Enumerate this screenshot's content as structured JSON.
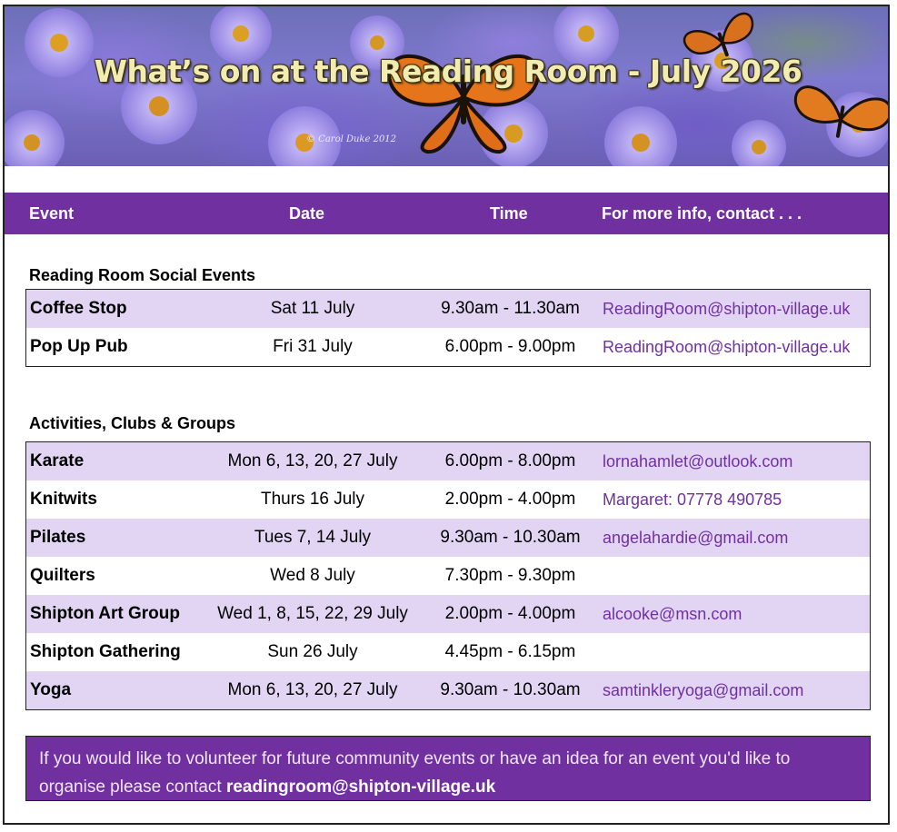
{
  "banner": {
    "title": "What’s on at the Reading Room - July 2026",
    "credit": "© Carol Duke 2012"
  },
  "columns": {
    "event": "Event",
    "date": "Date",
    "time": "Time",
    "contact": "For more info, contact . . ."
  },
  "social": {
    "title": "Reading Room Social Events",
    "rows": [
      {
        "name": "Coffee Stop",
        "date": "Sat 11 July",
        "time": "9.30am - 11.30am",
        "contact": "ReadingRoom@shipton-village.uk"
      },
      {
        "name": "Pop Up Pub",
        "date": "Fri 31 July",
        "time": "6.00pm - 9.00pm",
        "contact": "ReadingRoom@shipton-village.uk"
      }
    ]
  },
  "activities": {
    "title": "Activities, Clubs & Groups",
    "rows": [
      {
        "name": "Karate",
        "date": "Mon 6, 13, 20, 27 July",
        "time": "6.00pm - 8.00pm",
        "contact": "lornahamlet@outlook.com"
      },
      {
        "name": "Knitwits",
        "date": "Thurs 16 July",
        "time": "2.00pm - 4.00pm",
        "contact": "Margaret:  07778 490785"
      },
      {
        "name": "Pilates",
        "date": "Tues 7, 14 July",
        "time": "9.30am - 10.30am",
        "contact": "angelahardie@gmail.com"
      },
      {
        "name": "Quilters",
        "date": "Wed 8 July",
        "time": "7.30pm - 9.30pm",
        "contact": ""
      },
      {
        "name": "Shipton Art Group",
        "date": "Wed 1, 8, 15, 22, 29 July",
        "time": "2.00pm - 4.00pm",
        "contact": "alcooke@msn.com"
      },
      {
        "name": "Shipton Gathering",
        "date": "Sun 26 July",
        "time": "4.45pm - 6.15pm",
        "contact": ""
      },
      {
        "name": "Yoga",
        "date": "Mon 6, 13, 20, 27 July",
        "time": "9.30am - 10.30am",
        "contact": "samtinkleryoga@gmail.com"
      }
    ]
  },
  "volunteer": {
    "text": "If you would like to volunteer for future community events or have an idea for an event you'd like to organise please contact ",
    "email": "readingroom@shipton-village.uk"
  },
  "colors": {
    "accent": "#7030a0",
    "row_shade": "#e2d5f3",
    "title_gold": "#f3ecb0"
  }
}
